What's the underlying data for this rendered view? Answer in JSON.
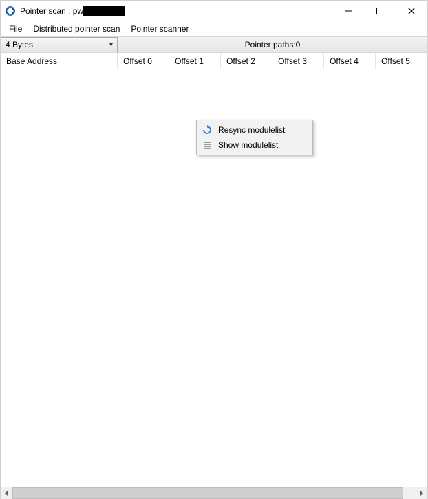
{
  "window": {
    "title_prefix": "Pointer scan : pw",
    "title_redacted": true
  },
  "menubar": {
    "items": [
      "File",
      "Distributed pointer scan",
      "Pointer scanner"
    ]
  },
  "toolbar": {
    "bytes_combo": {
      "selected": "4 Bytes"
    },
    "pointer_paths_label": "Pointer paths:0"
  },
  "columns": [
    {
      "label": "Base Address",
      "width": 178
    },
    {
      "label": "Offset 0",
      "width": 78
    },
    {
      "label": "Offset 1",
      "width": 78
    },
    {
      "label": "Offset 2",
      "width": 78
    },
    {
      "label": "Offset 3",
      "width": 78
    },
    {
      "label": "Offset 4",
      "width": 78
    },
    {
      "label": "Offset 5",
      "width": 78
    }
  ],
  "context_menu": {
    "items": [
      {
        "icon": "refresh-icon",
        "label": "Resync modulelist"
      },
      {
        "icon": "list-icon",
        "label": "Show modulelist"
      }
    ]
  }
}
